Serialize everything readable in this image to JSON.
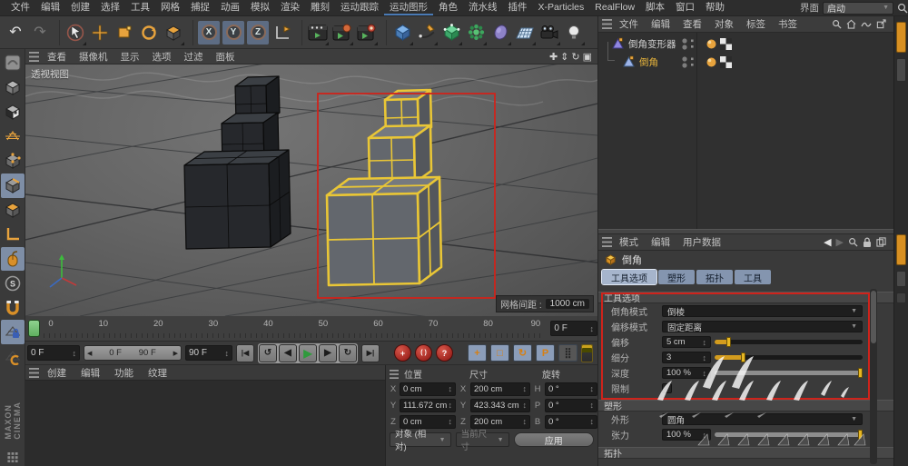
{
  "colors": {
    "accent_orange": "#e0a42b",
    "wire_yellow": "#e9c636",
    "annotation_red": "#cf231b",
    "tab_blue": "#8495af",
    "play_green": "#3da74a",
    "selection_blue": "#5d6c83"
  },
  "menubar": {
    "items": [
      "文件",
      "编辑",
      "创建",
      "选择",
      "工具",
      "网格",
      "捕捉",
      "动画",
      "模拟",
      "渲染",
      "雕刻",
      "运动跟踪",
      "运动图形",
      "角色",
      "流水线",
      "插件",
      "X-Particles",
      "RealFlow",
      "脚本",
      "窗口",
      "帮助"
    ],
    "interface_label": "界面",
    "interface_value": "启动"
  },
  "glyphs": {
    "dropdown": "▼",
    "stepper": "↕",
    "undo": "↶",
    "redo": "↷",
    "pan": "✚",
    "zoom_view": "⇕",
    "rotate_view": "↻",
    "maximize": "▣",
    "axis_x": "X",
    "axis_y": "Y",
    "axis_z": "Z",
    "back": "◀",
    "fwd": "▶",
    "go_start": "|◀",
    "prev_key": "↺",
    "prev_frame": "◀",
    "play": "▶",
    "next_frame": "▶",
    "next_key": "↻",
    "go_end": "▶|",
    "record_key": "+",
    "record_parens": "( )",
    "record_help": "?",
    "toggle_move": "+",
    "toggle_scale": "□",
    "toggle_rotate": "↻",
    "toggle_param": "P",
    "toggle_pla": "⣿",
    "snap": "S"
  },
  "viewport": {
    "menu": [
      "查看",
      "摄像机",
      "显示",
      "选项",
      "过滤",
      "面板"
    ],
    "view_label": "透视视图",
    "grid_spacing_label": "网格间距 :",
    "grid_spacing_value": "1000 cm"
  },
  "timeline": {
    "ticks": [
      "0",
      "10",
      "20",
      "30",
      "40",
      "50",
      "60",
      "70",
      "80",
      "90"
    ],
    "current_frame": "0 F",
    "scene_start": "0 F",
    "scene_end": "90 F",
    "range_start": "0 F",
    "range_end": "90 F"
  },
  "materials": {
    "menu": [
      "创建",
      "编辑",
      "功能",
      "纹理"
    ]
  },
  "coordinates": {
    "titles": [
      "位置",
      "尺寸",
      "旋转"
    ],
    "position": {
      "x_label": "X",
      "x": "0 cm",
      "y_label": "Y",
      "y": "111.672 cm",
      "z_label": "Z",
      "z": "0 cm"
    },
    "size": {
      "x_label": "X",
      "x": "200 cm",
      "y_label": "Y",
      "y": "423.343 cm",
      "z_label": "Z",
      "z": "200 cm"
    },
    "rotation": {
      "h_label": "H",
      "h": "0 °",
      "p_label": "P",
      "p": "0 °",
      "b_label": "B",
      "b": "0 °"
    },
    "mode_select": "对象 (相对)",
    "size_select": "当前尺寸",
    "apply_label": "应用"
  },
  "object_manager": {
    "menu": [
      "文件",
      "编辑",
      "查看",
      "对象",
      "标签",
      "书签"
    ],
    "objects": [
      {
        "name": "倒角变形器"
      },
      {
        "name": "倒角"
      }
    ]
  },
  "attributes": {
    "menu": [
      "模式",
      "编辑",
      "用户数据"
    ],
    "object_title": "倒角",
    "tabs": [
      "工具选项",
      "塑形",
      "拓扑",
      "工具"
    ],
    "tool_options": {
      "title": "工具选项",
      "bevel_mode_label": "倒角模式",
      "bevel_mode_value": "倒棱",
      "offset_mode_label": "偏移模式",
      "offset_mode_value": "固定距离",
      "offset_label": "偏移",
      "offset_value": "5 cm",
      "subdivision_label": "细分",
      "subdivision_value": "3",
      "depth_label": "深度",
      "depth_value": "100 %",
      "limit_label": "限制"
    },
    "shaping": {
      "title": "塑形",
      "shape_label": "外形",
      "shape_value": "圆角",
      "tension_label": "张力",
      "tension_value": "100 %"
    },
    "topology": {
      "title": "拓扑"
    }
  },
  "branding": {
    "vertical_text": "MAXON CINEMA"
  }
}
